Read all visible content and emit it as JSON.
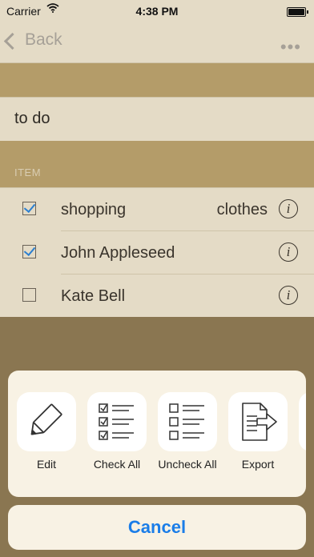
{
  "status_bar": {
    "carrier": "Carrier",
    "time": "4:38 PM"
  },
  "nav": {
    "back_label": "Back",
    "more_label": "•••"
  },
  "list_title": "to do",
  "section_header": "ITEM",
  "items": [
    {
      "label": "shopping",
      "detail": "clothes",
      "checked": true
    },
    {
      "label": "John Appleseed",
      "detail": "",
      "checked": true
    },
    {
      "label": "Kate Bell",
      "detail": "",
      "checked": false
    }
  ],
  "info_glyph": "i",
  "actions": [
    {
      "label": "Edit",
      "icon": "pencil-icon"
    },
    {
      "label": "Check All",
      "icon": "checklist-checked-icon"
    },
    {
      "label": "Uncheck All",
      "icon": "checklist-unchecked-icon"
    },
    {
      "label": "Export",
      "icon": "export-document-icon"
    }
  ],
  "cancel_label": "Cancel",
  "colors": {
    "accent": "#1a7de8",
    "checkmark": "#2b7fd0",
    "background": "#8a7651",
    "surface": "#e4dbc6"
  }
}
